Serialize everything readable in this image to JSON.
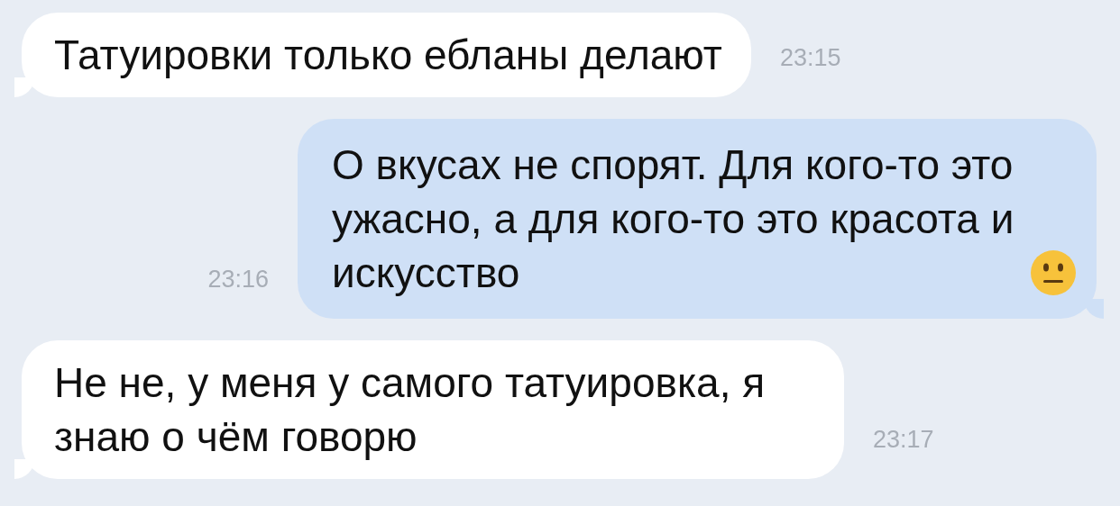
{
  "messages": [
    {
      "kind": "incoming",
      "text": "Татуировки только ебланы делают",
      "time": "23:15",
      "has_emoji": false
    },
    {
      "kind": "outgoing",
      "text": "О вкусах не спорят. Для кого-то это ужасно, а для кого-то это красота и искусство",
      "time": "23:16",
      "has_emoji": true
    },
    {
      "kind": "incoming",
      "text": "Не не, у меня у самого татуировка, я знаю о чём говорю",
      "time": "23:17",
      "has_emoji": false
    }
  ]
}
